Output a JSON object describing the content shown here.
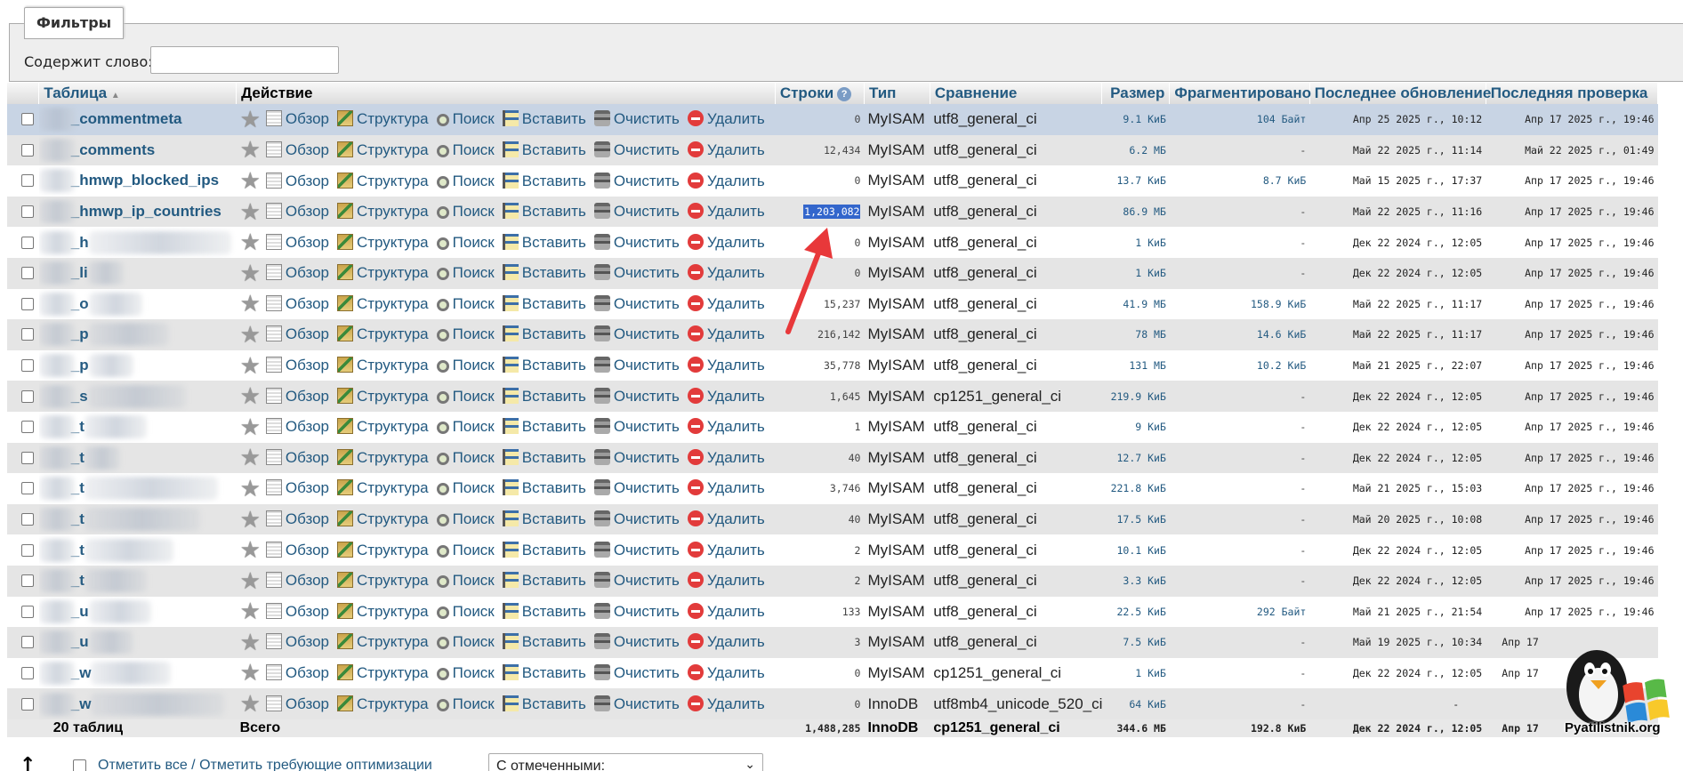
{
  "filters": {
    "legend": "Фильтры",
    "label": "Содержит слово:",
    "input_value": ""
  },
  "columns": {
    "table": "Таблица",
    "action": "Действие",
    "rows": "Строки",
    "type": "Тип",
    "collation": "Сравнение",
    "size": "Размер",
    "overhead": "Фрагментировано",
    "last_update": "Последнее обновление",
    "last_check": "Последняя проверка"
  },
  "actions": {
    "browse": "Обзор",
    "structure": "Структура",
    "search": "Поиск",
    "insert": "Вставить",
    "empty": "Очистить",
    "drop": "Удалить"
  },
  "rows": [
    {
      "name": "_commentmeta",
      "rows": "0",
      "type": "MyISAM",
      "collation": "utf8_general_ci",
      "size": "9.1 КиБ",
      "overhead": "104 Байт",
      "update": "Апр 25 2025 г., 10:12",
      "check": "Апр 17 2025 г., 19:46"
    },
    {
      "name": "_comments",
      "rows": "12,434",
      "type": "MyISAM",
      "collation": "utf8_general_ci",
      "size": "6.2 МБ",
      "overhead": "-",
      "update": "Май 22 2025 г., 11:14",
      "check": "Май 22 2025 г., 01:49"
    },
    {
      "name": "_hmwp_blocked_ips",
      "rows": "0",
      "type": "MyISAM",
      "collation": "utf8_general_ci",
      "size": "13.7 КиБ",
      "overhead": "8.7 КиБ",
      "update": "Май 15 2025 г., 17:37",
      "check": "Апр 17 2025 г., 19:46"
    },
    {
      "name": "_hmwp_ip_countries",
      "rows": "1,203,082",
      "type": "MyISAM",
      "collation": "utf8_general_ci",
      "size": "86.9 МБ",
      "overhead": "-",
      "update": "Май 22 2025 г., 11:16",
      "check": "Апр 17 2025 г., 19:46"
    },
    {
      "name": "_h",
      "rows": "0",
      "type": "MyISAM",
      "collation": "utf8_general_ci",
      "size": "1 КиБ",
      "overhead": "-",
      "update": "Дек 22 2024 г., 12:05",
      "check": "Апр 17 2025 г., 19:46"
    },
    {
      "name": "_li",
      "rows": "0",
      "type": "MyISAM",
      "collation": "utf8_general_ci",
      "size": "1 КиБ",
      "overhead": "-",
      "update": "Дек 22 2024 г., 12:05",
      "check": "Апр 17 2025 г., 19:46"
    },
    {
      "name": "_o",
      "rows": "15,237",
      "type": "MyISAM",
      "collation": "utf8_general_ci",
      "size": "41.9 МБ",
      "overhead": "158.9 КиБ",
      "update": "Май 22 2025 г., 11:17",
      "check": "Апр 17 2025 г., 19:46"
    },
    {
      "name": "_p",
      "rows": "216,142",
      "type": "MyISAM",
      "collation": "utf8_general_ci",
      "size": "78 МБ",
      "overhead": "14.6 КиБ",
      "update": "Май 22 2025 г., 11:17",
      "check": "Апр 17 2025 г., 19:46"
    },
    {
      "name": "_p",
      "rows": "35,778",
      "type": "MyISAM",
      "collation": "utf8_general_ci",
      "size": "131 МБ",
      "overhead": "10.2 КиБ",
      "update": "Май 21 2025 г., 22:07",
      "check": "Апр 17 2025 г., 19:46"
    },
    {
      "name": "_s",
      "rows": "1,645",
      "type": "MyISAM",
      "collation": "cp1251_general_ci",
      "size": "219.9 КиБ",
      "overhead": "-",
      "update": "Дек 22 2024 г., 12:05",
      "check": "Апр 17 2025 г., 19:46"
    },
    {
      "name": "_t",
      "rows": "1",
      "type": "MyISAM",
      "collation": "utf8_general_ci",
      "size": "9 КиБ",
      "overhead": "-",
      "update": "Дек 22 2024 г., 12:05",
      "check": "Апр 17 2025 г., 19:46"
    },
    {
      "name": "_t",
      "rows": "40",
      "type": "MyISAM",
      "collation": "utf8_general_ci",
      "size": "12.7 КиБ",
      "overhead": "-",
      "update": "Дек 22 2024 г., 12:05",
      "check": "Апр 17 2025 г., 19:46"
    },
    {
      "name": "_t",
      "rows": "3,746",
      "type": "MyISAM",
      "collation": "utf8_general_ci",
      "size": "221.8 КиБ",
      "overhead": "-",
      "update": "Май 21 2025 г., 15:03",
      "check": "Апр 17 2025 г., 19:46"
    },
    {
      "name": "_t",
      "rows": "40",
      "type": "MyISAM",
      "collation": "utf8_general_ci",
      "size": "17.5 КиБ",
      "overhead": "-",
      "update": "Май 20 2025 г., 10:08",
      "check": "Апр 17 2025 г., 19:46"
    },
    {
      "name": "_t",
      "rows": "2",
      "type": "MyISAM",
      "collation": "utf8_general_ci",
      "size": "10.1 КиБ",
      "overhead": "-",
      "update": "Дек 22 2024 г., 12:05",
      "check": "Апр 17 2025 г., 19:46"
    },
    {
      "name": "_t",
      "rows": "2",
      "type": "MyISAM",
      "collation": "utf8_general_ci",
      "size": "3.3 КиБ",
      "overhead": "-",
      "update": "Дек 22 2024 г., 12:05",
      "check": "Апр 17 2025 г., 19:46"
    },
    {
      "name": "_u",
      "rows": "133",
      "type": "MyISAM",
      "collation": "utf8_general_ci",
      "size": "22.5 КиБ",
      "overhead": "292 Байт",
      "update": "Май 21 2025 г., 21:54",
      "check": "Апр 17 2025 г., 19:46"
    },
    {
      "name": "_u",
      "rows": "3",
      "type": "MyISAM",
      "collation": "utf8_general_ci",
      "size": "7.5 КиБ",
      "overhead": "-",
      "update": "Май 19 2025 г., 10:34",
      "check": "Апр 17"
    },
    {
      "name": "_w",
      "rows": "0",
      "type": "MyISAM",
      "collation": "cp1251_general_ci",
      "size": "1 КиБ",
      "overhead": "-",
      "update": "Дек 22 2024 г., 12:05",
      "check": "Апр 17"
    },
    {
      "name": "_w",
      "rows": "0",
      "type": "InnoDB",
      "collation": "utf8mb4_unicode_520_ci",
      "size": "64 КиБ",
      "overhead": "-",
      "update": "-",
      "check": ""
    }
  ],
  "totals": {
    "count": "20 таблиц",
    "label": "Всего",
    "rows": "1,488,285",
    "type": "InnoDB",
    "collation": "cp1251_general_ci",
    "size": "344.6 МБ",
    "overhead": "192.8 КиБ",
    "update": "Дек 22 2024 г., 12:05",
    "check": "Апр 17"
  },
  "bottom": {
    "check_all": "Отметить все / Отметить требующие оптимизации",
    "with_selected": "С отмеченными:"
  },
  "logo": {
    "text": "Pyatilistnik.org"
  },
  "colors": {
    "link": "#235a81",
    "row_even": "#e5e5e5",
    "row_highlight": "#c8d4e4",
    "selection": "#3366cc",
    "arrow": "#e8383a"
  }
}
